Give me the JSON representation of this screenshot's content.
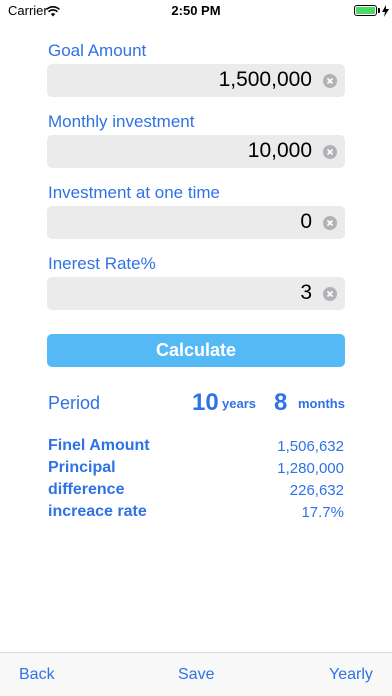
{
  "status_bar": {
    "carrier": "Carrier",
    "time": "2:50 PM",
    "wifi_icon": "wifi-icon",
    "battery_icon": "battery-icon",
    "charging_icon": "charging-bolt-icon"
  },
  "colors": {
    "accent": "#2f72e6",
    "button": "#54b9f5",
    "field_bg": "#ebebeb"
  },
  "fields": [
    {
      "label": "Goal Amount",
      "value": "1,500,000"
    },
    {
      "label": "Monthly investment",
      "value": "10,000"
    },
    {
      "label": "Investment at one time",
      "value": "0"
    },
    {
      "label": "Inerest Rate%",
      "value": "3"
    }
  ],
  "calculate_label": "Calculate",
  "period": {
    "label": "Period",
    "years": "10",
    "years_unit": "years",
    "months": "8",
    "months_unit": "months"
  },
  "results": [
    {
      "label": "Finel Amount",
      "value": "1,506,632"
    },
    {
      "label": "Principal",
      "value": "1,280,000"
    },
    {
      "label": "difference",
      "value": "226,632"
    },
    {
      "label": "increace rate",
      "value": "17.7%"
    }
  ],
  "toolbar": {
    "back": "Back",
    "save": "Save",
    "yearly": "Yearly"
  }
}
